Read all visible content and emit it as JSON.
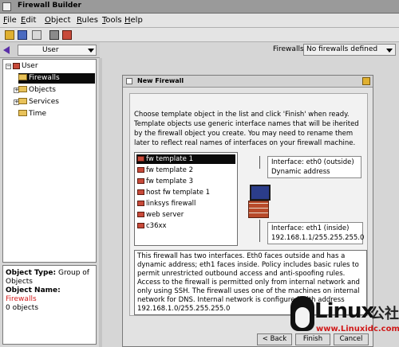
{
  "window": {
    "title": "Firewall Builder"
  },
  "menu": {
    "items": [
      {
        "pre": "",
        "key": "F",
        "post": "ile"
      },
      {
        "pre": "",
        "key": "E",
        "post": "dit"
      },
      {
        "pre": "",
        "key": "O",
        "post": "bject"
      },
      {
        "pre": "",
        "key": "R",
        "post": "ules"
      },
      {
        "pre": "",
        "key": "T",
        "post": "ools"
      },
      {
        "pre": "",
        "key": "H",
        "post": "elp"
      }
    ]
  },
  "tree_selector": {
    "value": "User"
  },
  "firewalls": {
    "label": "Firewalls:",
    "value": "No firewalls defined"
  },
  "tree": {
    "root": "User",
    "nodes": [
      "Firewalls",
      "Objects",
      "Services",
      "Time"
    ]
  },
  "info": {
    "type_label": "Object Type:",
    "type_value": "Group of Objects",
    "name_label": "Object Name:",
    "name_value": "Firewalls",
    "count": "0 objects"
  },
  "dialog": {
    "title": "New Firewall",
    "intro": "Choose template object in the list and click 'Finish' when ready. Template objects use generic interface names that will be iherited by the firewall object you create. You may need to rename them later to reflect real names of interfaces on your firewall machine.",
    "templates": [
      "fw template 1",
      "fw template 2",
      "fw template 3",
      "host fw template 1",
      "linksys firewall",
      "web server",
      "c36xx"
    ],
    "iface_outside_line1": "Interface: eth0 (outside)",
    "iface_outside_line2": "Dynamic address",
    "iface_inside_line1": "Interface: eth1 (inside)",
    "iface_inside_line2": "192.168.1.1/255.255.255.0",
    "description": "This firewall has two interfaces. Eth0 faces outside and has a dynamic address; eth1 faces inside. Policy includes basic rules to permit unrestricted outbound access and anti-spoofing rules. Access to the firewall is permitted only from internal network and only using SSH. The firewall uses one of the machines on internal network for DNS. Internal network is configured with address 192.168.1.0/255.255.255.0",
    "back_label": "< Back",
    "finish_label": "Finish",
    "cancel_label": "Cancel"
  },
  "watermark": {
    "logo": "Linux",
    "logo_cn": "公社",
    "url": "www.Linuxidc.com"
  },
  "colors": {
    "selection": "#0a0a0a",
    "object_name": "#d41c1c",
    "watermark_url": "#d01a1a"
  }
}
